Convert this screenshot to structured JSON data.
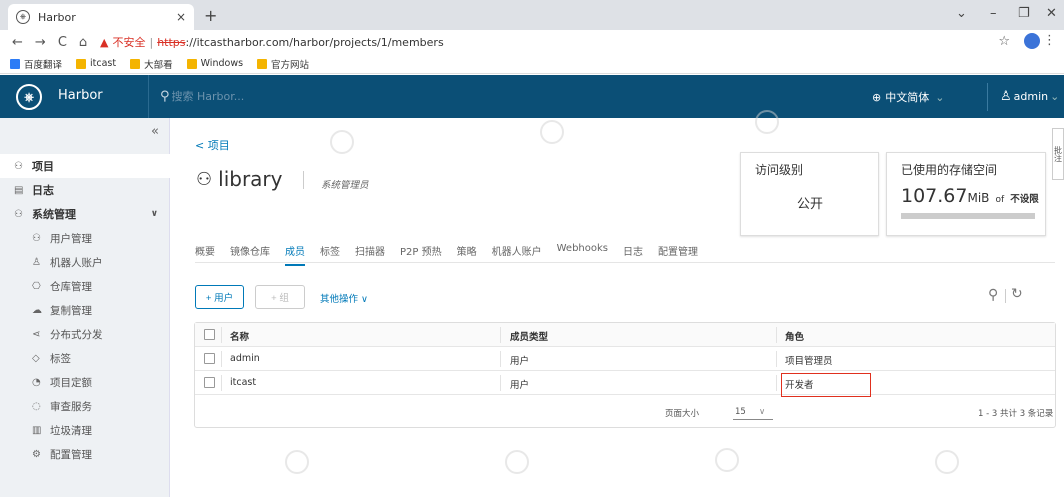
{
  "browser": {
    "tab_title": "Harbor",
    "tab_close": "×",
    "new_tab": "+",
    "win_min": "–",
    "win_restore": "❐",
    "win_close": "✕",
    "win_menu": "⌄",
    "insecure_label": "不安全",
    "url_scheme": "https",
    "url_rest": "://itcastharbor.com/harbor/projects/1/members",
    "bookmarks": [
      {
        "label": "百度翻译",
        "color": "#2d7cf6"
      },
      {
        "label": "itcast",
        "color": "#f4b400"
      },
      {
        "label": "大部看",
        "color": "#f4b400"
      },
      {
        "label": "Windows",
        "color": "#f4b400"
      },
      {
        "label": "官方网站",
        "color": "#f4b400"
      }
    ]
  },
  "header": {
    "brand": "Harbor",
    "search_placeholder": "搜索 Harbor...",
    "language": "中文简体",
    "user": "admin"
  },
  "sidebar": {
    "items": [
      {
        "label": "项目",
        "icon": "project-icon",
        "glyph": "⚇",
        "type": "main",
        "active": true
      },
      {
        "label": "日志",
        "icon": "log-icon",
        "glyph": "▤",
        "type": "main"
      },
      {
        "label": "系统管理",
        "icon": "admin-icon",
        "glyph": "⚇",
        "type": "main",
        "expand": true
      },
      {
        "label": "用户管理",
        "icon": "users-icon",
        "glyph": "⚇",
        "type": "sub"
      },
      {
        "label": "机器人账户",
        "icon": "robot-icon",
        "glyph": "♙",
        "type": "sub"
      },
      {
        "label": "仓库管理",
        "icon": "registry-icon",
        "glyph": "⎔",
        "type": "sub"
      },
      {
        "label": "复制管理",
        "icon": "replication-icon",
        "glyph": "☁",
        "type": "sub"
      },
      {
        "label": "分布式分发",
        "icon": "distribution-icon",
        "glyph": "⋖",
        "type": "sub"
      },
      {
        "label": "标签",
        "icon": "label-icon",
        "glyph": "◇",
        "type": "sub"
      },
      {
        "label": "项目定额",
        "icon": "quota-icon",
        "glyph": "◔",
        "type": "sub"
      },
      {
        "label": "审查服务",
        "icon": "shield-icon",
        "glyph": "◌",
        "type": "sub"
      },
      {
        "label": "垃圾清理",
        "icon": "trash-icon",
        "glyph": "▥",
        "type": "sub"
      },
      {
        "label": "配置管理",
        "icon": "gear-icon",
        "glyph": "⚙",
        "type": "sub"
      }
    ]
  },
  "main": {
    "breadcrumb": "< 项目",
    "title": "library",
    "role": "系统管理员",
    "cards": {
      "access_title": "访问级别",
      "access_value": "公开",
      "storage_title": "已使用的存储空间",
      "storage_value": "107.67",
      "storage_unit": "MiB",
      "storage_of": "of",
      "storage_limit": "不设限"
    },
    "tabs": [
      "概要",
      "镜像仓库",
      "成员",
      "标签",
      "扫描器",
      "P2P 预热",
      "策略",
      "机器人账户",
      "Webhooks",
      "日志",
      "配置管理"
    ],
    "active_tab": 2,
    "buttons": {
      "add_user": "+ 用户",
      "add_group": "+ 组",
      "more_actions": "其他操作 ∨"
    },
    "table": {
      "headers": [
        "名称",
        "成员类型",
        "角色"
      ],
      "rows": [
        {
          "name": "admin",
          "type": "用户",
          "role": "项目管理员"
        },
        {
          "name": "itcast",
          "type": "用户",
          "role": "开发者"
        }
      ],
      "page_size_label": "页面大小",
      "page_size": "15",
      "page_size_caret": "∨",
      "total": "1 - 3 共计 3 条记录"
    }
  },
  "right_tab": "批注"
}
